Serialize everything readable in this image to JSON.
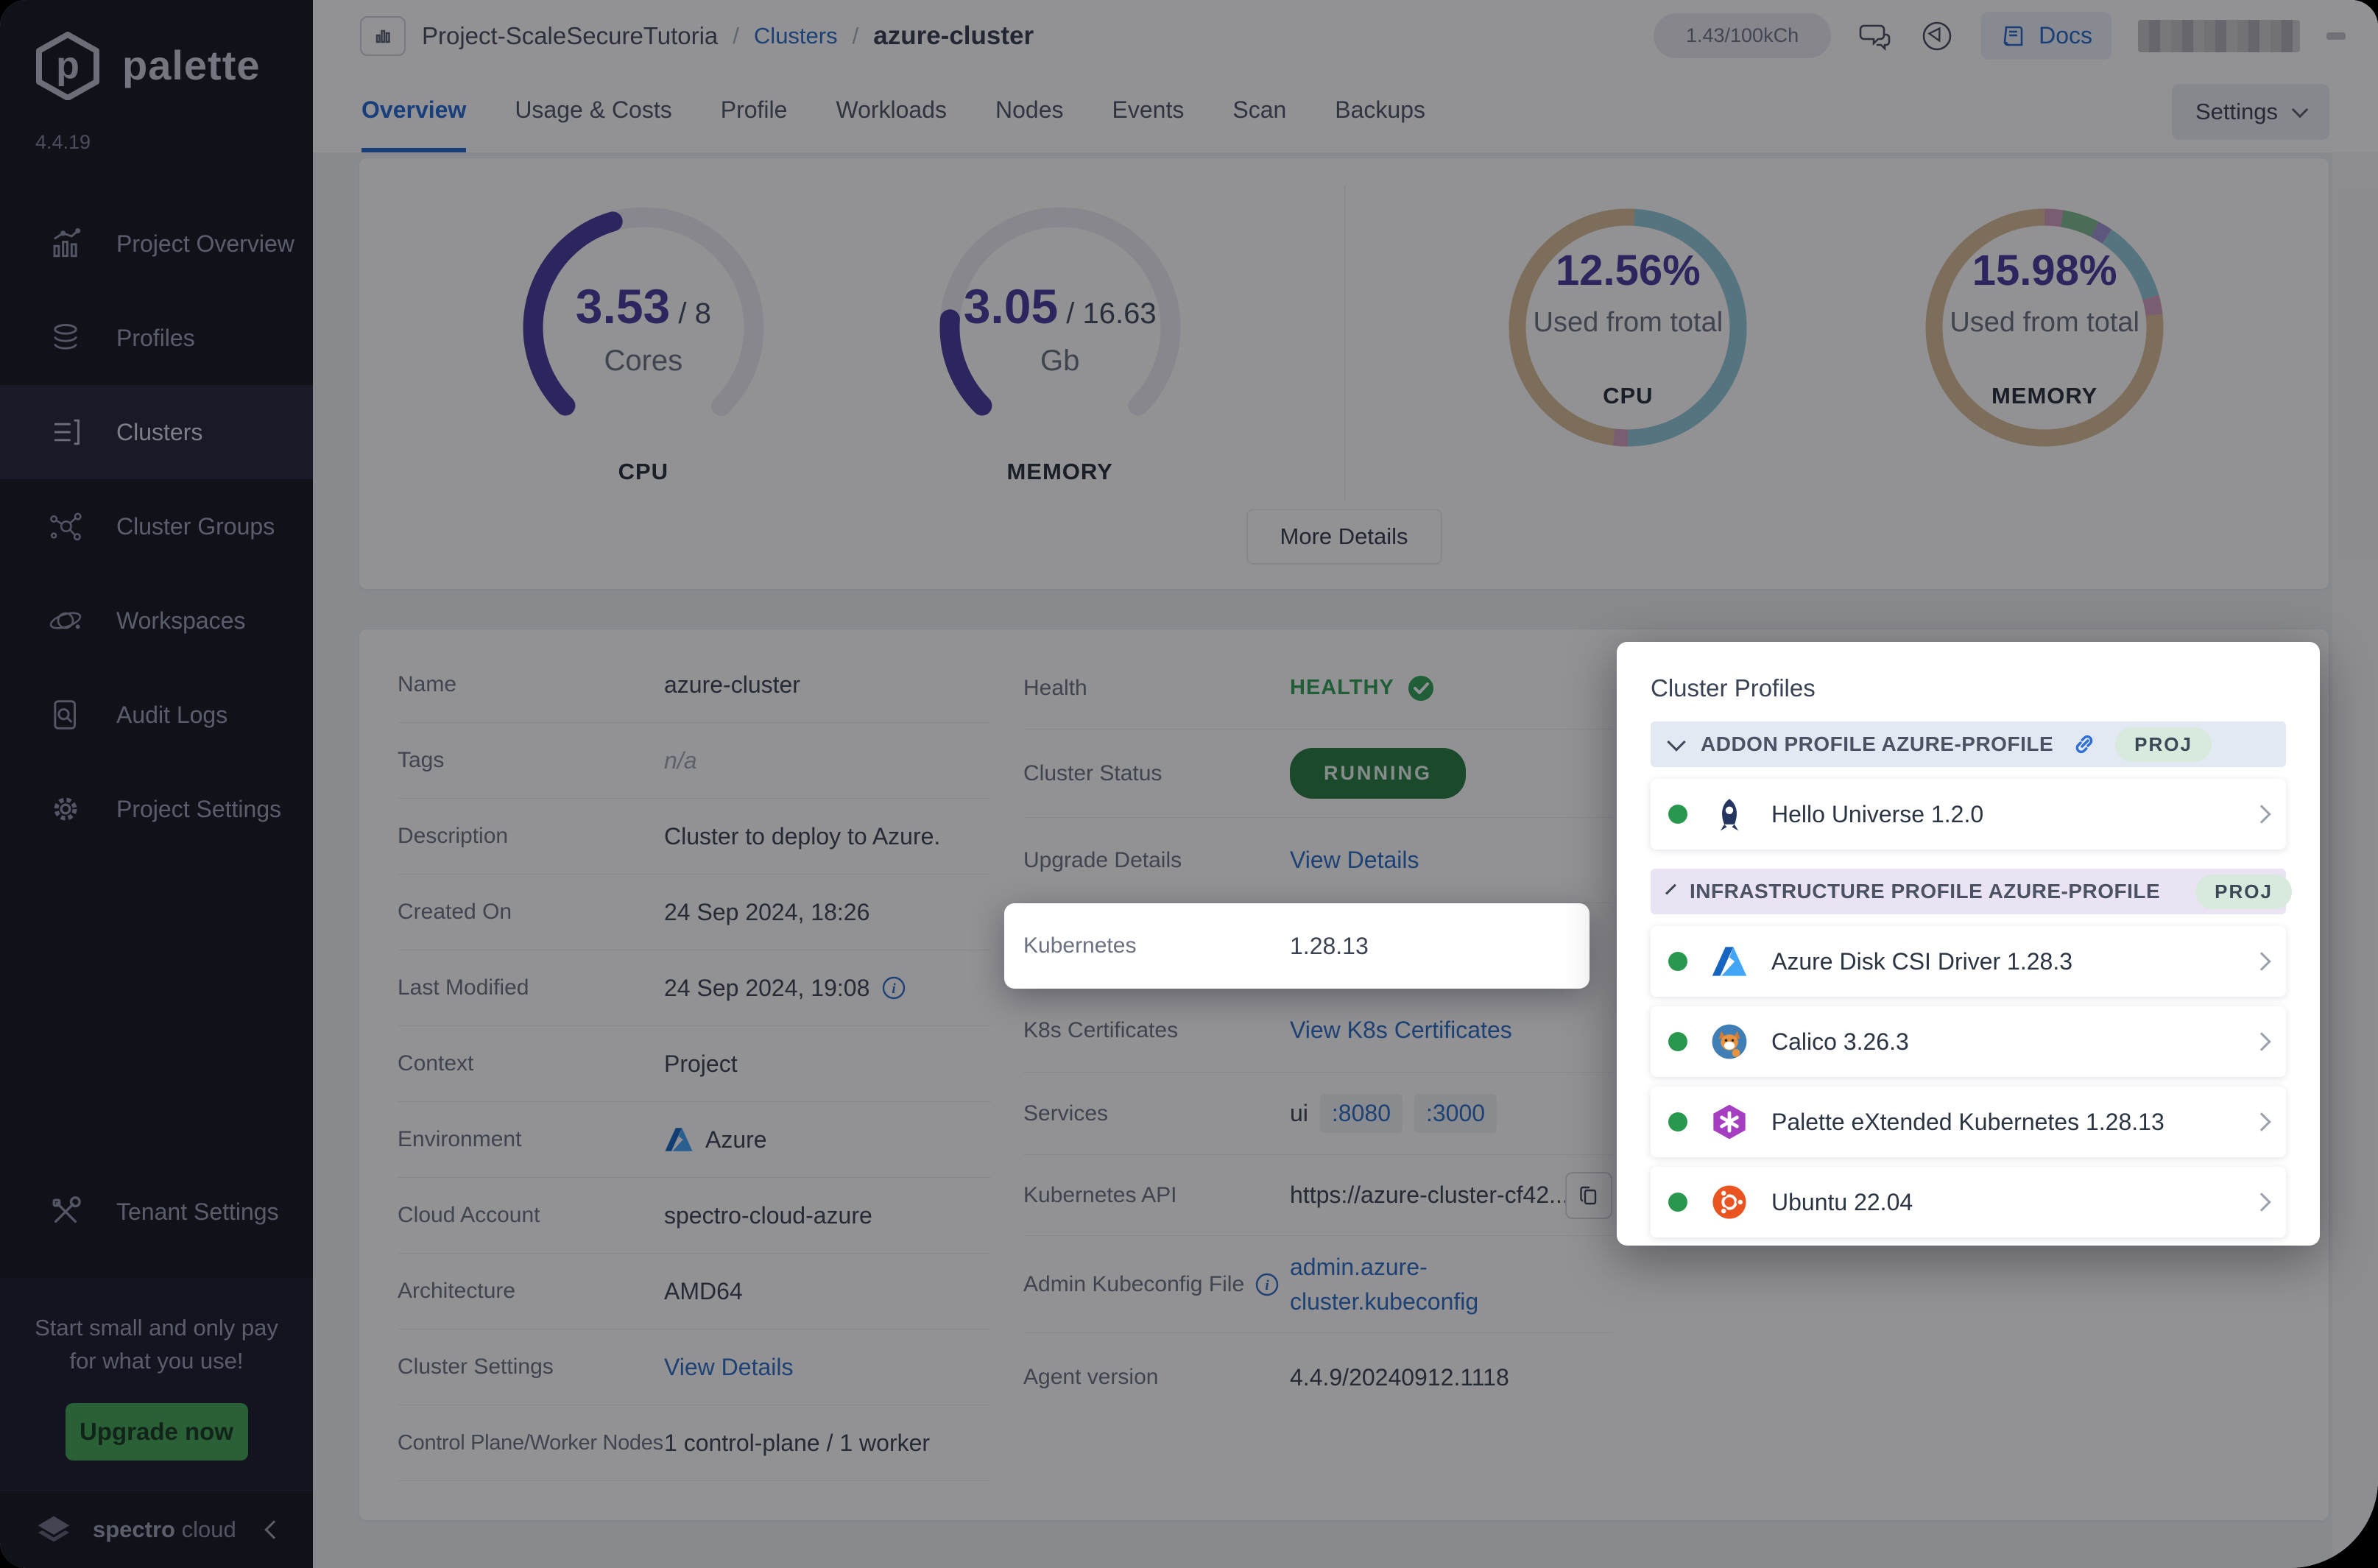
{
  "brand": {
    "name": "palette",
    "version": "4.4.19"
  },
  "colors": {
    "accent_indigo": "#473b9b",
    "link_blue": "#2a6cc4",
    "active_tab_blue": "#2166d1",
    "healthy_green": "#2ea052",
    "running_green": "#257a41",
    "upgrade_green": "#41a452",
    "donut_tan": "#d8bd95",
    "donut_teal": "#8fc9d9",
    "donut_pink": "#d49ebe",
    "donut_green": "#7fba8c",
    "donut_purple": "#9e92d3",
    "sidebar_bg": "#14141f"
  },
  "sidebar": {
    "items": [
      {
        "label": "Project Overview"
      },
      {
        "label": "Profiles"
      },
      {
        "label": "Clusters"
      },
      {
        "label": "Cluster Groups"
      },
      {
        "label": "Workspaces"
      },
      {
        "label": "Audit Logs"
      },
      {
        "label": "Project Settings"
      }
    ],
    "tenant_settings_label": "Tenant Settings",
    "promo": {
      "line1": "Start small and only pay",
      "line2": "for what you use!",
      "cta": "Upgrade now"
    },
    "footer": {
      "brand_strong": "spectro",
      "brand_light": " cloud"
    }
  },
  "header": {
    "project": "Project-ScaleSecureTutoria",
    "sep": "/",
    "breadcrumb_link": "Clusters",
    "breadcrumb_current": "azure-cluster",
    "usage_pill": "1.43/100kCh",
    "docs_label": "Docs"
  },
  "tabs": {
    "items": [
      "Overview",
      "Usage & Costs",
      "Profile",
      "Workloads",
      "Nodes",
      "Events",
      "Scan",
      "Backups"
    ],
    "settings_label": "Settings"
  },
  "stats": {
    "more_details_label": "More Details",
    "cpu_gauge": {
      "value": "3.53",
      "total": " / 8",
      "unit": "Cores",
      "label": "CPU"
    },
    "memory_gauge": {
      "value": "3.05",
      "total": " / 16.63",
      "unit": "Gb",
      "label": "MEMORY"
    },
    "cpu_donut": {
      "percent": "12.56%",
      "caption": "Used from total",
      "label": "CPU"
    },
    "memory_donut": {
      "percent": "15.98%",
      "caption": "Used from total",
      "label": "MEMORY"
    }
  },
  "chart_data": [
    {
      "type": "gauge",
      "title": "CPU",
      "value": 3.53,
      "max": 8,
      "unit": "Cores",
      "sweep_deg": 270
    },
    {
      "type": "gauge",
      "title": "MEMORY",
      "value": 3.05,
      "max": 16.63,
      "unit": "Gb",
      "sweep_deg": 270
    },
    {
      "type": "pie",
      "title": "CPU used from total",
      "used_percent": 12.56,
      "segments": [
        {
          "name": "teal",
          "value": 49
        },
        {
          "name": "pink",
          "value": 2
        },
        {
          "name": "tan",
          "value": 49
        }
      ]
    },
    {
      "type": "pie",
      "title": "MEMORY used from total",
      "used_percent": 15.98,
      "segments": [
        {
          "name": "pink",
          "value": 2.5
        },
        {
          "name": "green",
          "value": 5
        },
        {
          "name": "purple",
          "value": 2
        },
        {
          "name": "teal",
          "value": 11
        },
        {
          "name": "pink",
          "value": 2.5
        },
        {
          "name": "tan",
          "value": 77
        }
      ]
    }
  ],
  "details": {
    "left": [
      {
        "label": "Name",
        "value": "azure-cluster"
      },
      {
        "label": "Tags",
        "value": "n/a"
      },
      {
        "label": "Description",
        "value": "Cluster to deploy to Azure."
      },
      {
        "label": "Created On",
        "value": "24 Sep 2024, 18:26"
      },
      {
        "label": "Last Modified",
        "value": "24 Sep 2024, 19:08"
      },
      {
        "label": "Context",
        "value": "Project"
      },
      {
        "label": "Environment",
        "value": "Azure"
      },
      {
        "label": "Cloud Account",
        "value": "spectro-cloud-azure"
      },
      {
        "label": "Architecture",
        "value": "AMD64"
      },
      {
        "label": "Cluster Settings",
        "value": "View Details"
      },
      {
        "label": "Control Plane/Worker Nodes",
        "value": "1 control-plane / 1 worker"
      }
    ],
    "right": {
      "health_label": "Health",
      "health_value": "HEALTHY",
      "status_label": "Cluster Status",
      "status_value": "RUNNING",
      "upgrade_label": "Upgrade Details",
      "upgrade_value": "View Details",
      "kubernetes_label": "Kubernetes",
      "kubernetes_value": "1.28.13",
      "certs_label": "K8s Certificates",
      "certs_value": "View K8s Certificates",
      "services_label": "Services",
      "services_prefix": "ui",
      "services_ports": [
        ":8080",
        ":3000"
      ],
      "api_label": "Kubernetes API",
      "api_value": "https://azure-cluster-cf42...",
      "kubeconfig_label": "Admin Kubeconfig File",
      "kubeconfig_line1": "admin.azure-",
      "kubeconfig_line2": "cluster.kubeconfig",
      "agent_label": "Agent version",
      "agent_value": "4.4.9/20240912.1118"
    }
  },
  "cluster_profiles": {
    "title": "Cluster Profiles",
    "sections": [
      {
        "header": "ADDON PROFILE AZURE-PROFILE",
        "badge": "PROJ",
        "items": [
          {
            "name": "Hello Universe 1.2.0"
          }
        ]
      },
      {
        "header": "INFRASTRUCTURE PROFILE AZURE-PROFILE",
        "badge": "PROJ",
        "items": [
          {
            "name": "Azure Disk CSI Driver 1.28.3"
          },
          {
            "name": "Calico 3.26.3"
          },
          {
            "name": "Palette eXtended Kubernetes 1.28.13"
          },
          {
            "name": "Ubuntu 22.04"
          }
        ]
      }
    ]
  }
}
